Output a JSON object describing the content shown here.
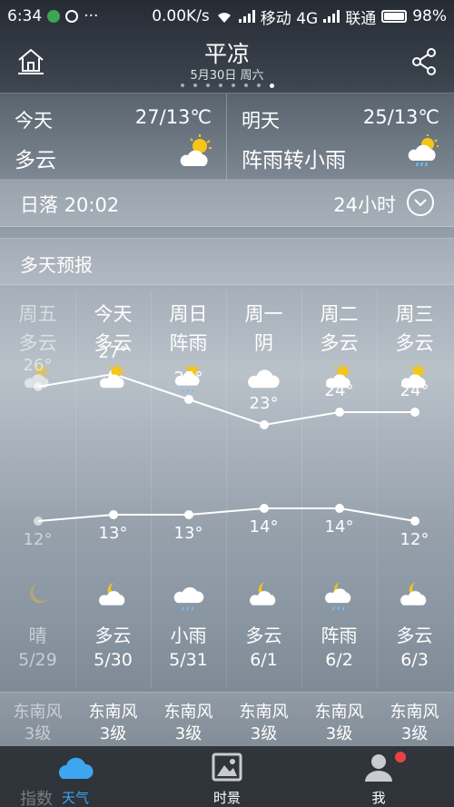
{
  "status": {
    "time": "6:34",
    "speed": "0.00K/s",
    "carrier1": "移动 4G",
    "carrier2": "联通",
    "battery": "98%"
  },
  "header": {
    "city": "平凉",
    "date": "5月30日 周六",
    "page_dots": 8,
    "active_dot": 7
  },
  "today": {
    "label": "今天",
    "temp": "27/13℃",
    "condition": "多云",
    "icon": "partly-cloudy-icon"
  },
  "tomorrow": {
    "label": "明天",
    "temp": "25/13℃",
    "condition": "阵雨转小雨",
    "icon": "shower-icon"
  },
  "sunset": {
    "text": "日落 20:02",
    "hours_label": "24小时"
  },
  "forecast": {
    "title": "多天预报",
    "days": [
      {
        "weekday": "周五",
        "day_cond": "多云",
        "day_icon": "partly-cloudy-icon",
        "high": "26°",
        "low": "12°",
        "night_icon": "moon-icon",
        "night_cond": "晴",
        "date": "5/29",
        "wind": "东南风",
        "wind_level": "3级",
        "past": true
      },
      {
        "weekday": "今天",
        "day_cond": "多云",
        "day_icon": "partly-cloudy-icon",
        "high": "27°",
        "low": "13°",
        "night_icon": "moon-cloud-icon",
        "night_cond": "多云",
        "date": "5/30",
        "wind": "东南风",
        "wind_level": "3级",
        "past": false
      },
      {
        "weekday": "周日",
        "day_cond": "阵雨",
        "day_icon": "shower-icon",
        "high": "25°",
        "low": "13°",
        "night_icon": "rain-cloud-icon",
        "night_cond": "小雨",
        "date": "5/31",
        "wind": "东南风",
        "wind_level": "3级",
        "past": false
      },
      {
        "weekday": "周一",
        "day_cond": "阴",
        "day_icon": "cloud-icon",
        "high": "23°",
        "low": "14°",
        "night_icon": "moon-cloud-icon",
        "night_cond": "多云",
        "date": "6/1",
        "wind": "东南风",
        "wind_level": "3级",
        "past": false
      },
      {
        "weekday": "周二",
        "day_cond": "多云",
        "day_icon": "partly-cloudy-icon",
        "high": "24°",
        "low": "14°",
        "night_icon": "moon-shower-icon",
        "night_cond": "阵雨",
        "date": "6/2",
        "wind": "东南风",
        "wind_level": "3级",
        "past": false
      },
      {
        "weekday": "周三",
        "day_cond": "多云",
        "day_icon": "partly-cloudy-icon",
        "high": "24°",
        "low": "12°",
        "night_icon": "moon-cloud-icon",
        "night_cond": "多云",
        "date": "6/3",
        "wind": "东南风",
        "wind_level": "3级",
        "past": false
      }
    ]
  },
  "tabs": [
    {
      "label": "天气",
      "active": true
    },
    {
      "label": "时景",
      "active": false
    },
    {
      "label": "我",
      "active": false,
      "badge": true
    }
  ],
  "ghost_text": "指数",
  "colors": {
    "tab_active": "#3ea6f0",
    "badge": "#e84343",
    "sun": "#f5c518"
  }
}
